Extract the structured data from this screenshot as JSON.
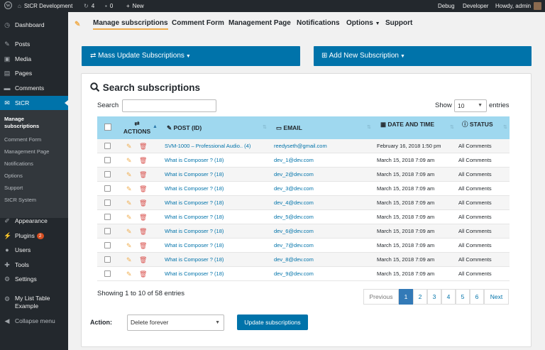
{
  "adminbar": {
    "wp_icon": "wordpress-logo-icon",
    "site_name": "StCR Development",
    "updates_count": "4",
    "comments_count": "0",
    "new_label": "New",
    "debug": "Debug",
    "developer": "Developer",
    "howdy": "Howdy, admin"
  },
  "sidebar": {
    "items": [
      {
        "label": "Dashboard",
        "icon": "dashboard-icon"
      },
      {
        "label": "Posts",
        "icon": "pin-icon"
      },
      {
        "label": "Media",
        "icon": "media-icon"
      },
      {
        "label": "Pages",
        "icon": "pages-icon"
      },
      {
        "label": "Comments",
        "icon": "comments-icon"
      },
      {
        "label": "StCR",
        "icon": "mail-icon"
      },
      {
        "label": "Appearance",
        "icon": "paintbrush-icon"
      },
      {
        "label": "Plugins",
        "icon": "plugin-icon",
        "badge": "2"
      },
      {
        "label": "Users",
        "icon": "users-icon"
      },
      {
        "label": "Tools",
        "icon": "wrench-icon"
      },
      {
        "label": "Settings",
        "icon": "settings-icon"
      },
      {
        "label": "My List Table Example",
        "icon": "generic-icon"
      },
      {
        "label": "Collapse menu",
        "icon": "collapse-icon"
      }
    ],
    "submenu": [
      "Manage subscriptions",
      "Comment Form",
      "Management Page",
      "Notifications",
      "Options",
      "Support",
      "StCR System"
    ]
  },
  "topnav": {
    "tabs": [
      "Manage subscriptions",
      "Comment Form",
      "Management Page",
      "Notifications",
      "Options",
      "Support"
    ]
  },
  "mass_update_label": "Mass Update Subscriptions",
  "add_new_label": "Add New Subscription",
  "search_title": "Search subscriptions",
  "search_label": "Search",
  "search_value": "",
  "show_label": "Show",
  "entries_label": "entries",
  "page_length": "10",
  "table": {
    "headers": {
      "actions": "ACTIONS",
      "post": "POST (ID)",
      "email": "EMAIL",
      "date": "DATE AND TIME",
      "status": "STATUS"
    },
    "rows": [
      {
        "post": "SVM-1000 – Professional Audio.. (4)",
        "email": "reedyseth@gmail.com",
        "date": "February 16, 2018 1:50 pm",
        "status": "All Comments"
      },
      {
        "post": "What is Composer ? (18)",
        "email": "dev_1@dev.com",
        "date": "March 15, 2018 7:09 am",
        "status": "All Comments"
      },
      {
        "post": "What is Composer ? (18)",
        "email": "dev_2@dev.com",
        "date": "March 15, 2018 7:09 am",
        "status": "All Comments"
      },
      {
        "post": "What is Composer ? (18)",
        "email": "dev_3@dev.com",
        "date": "March 15, 2018 7:09 am",
        "status": "All Comments"
      },
      {
        "post": "What is Composer ? (18)",
        "email": "dev_4@dev.com",
        "date": "March 15, 2018 7:09 am",
        "status": "All Comments"
      },
      {
        "post": "What is Composer ? (18)",
        "email": "dev_5@dev.com",
        "date": "March 15, 2018 7:09 am",
        "status": "All Comments"
      },
      {
        "post": "What is Composer ? (18)",
        "email": "dev_6@dev.com",
        "date": "March 15, 2018 7:09 am",
        "status": "All Comments"
      },
      {
        "post": "What is Composer ? (18)",
        "email": "dev_7@dev.com",
        "date": "March 15, 2018 7:09 am",
        "status": "All Comments"
      },
      {
        "post": "What is Composer ? (18)",
        "email": "dev_8@dev.com",
        "date": "March 15, 2018 7:09 am",
        "status": "All Comments"
      },
      {
        "post": "What is Composer ? (18)",
        "email": "dev_9@dev.com",
        "date": "March 15, 2018 7:09 am",
        "status": "All Comments"
      }
    ]
  },
  "info": "Showing 1 to 10 of 58 entries",
  "pagination": {
    "previous": "Previous",
    "pages": [
      "1",
      "2",
      "3",
      "4",
      "5",
      "6"
    ],
    "next": "Next",
    "current": "1"
  },
  "action_label": "Action:",
  "action_value": "Delete forever",
  "update_button": "Update subscriptions",
  "colors": {
    "accent": "#0073aa",
    "header": "#9fd8ef",
    "edit": "#f0ad4e",
    "delete": "#d9534f"
  }
}
